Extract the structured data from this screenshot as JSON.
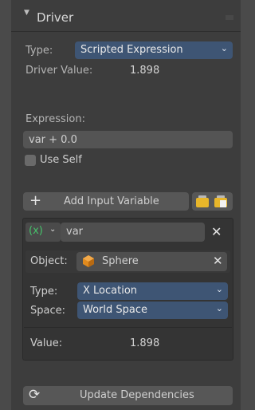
{
  "panel": {
    "title": "Driver"
  },
  "type_row": {
    "label": "Type:",
    "selected": "Scripted Expression"
  },
  "driver_value": {
    "label": "Driver Value:",
    "value": "1.898"
  },
  "expression": {
    "label": "Expression:",
    "value": "var + 0.0"
  },
  "use_self": {
    "label": "Use Self",
    "checked": false
  },
  "add_variable": {
    "label": "Add Input Variable"
  },
  "variable": {
    "type_badge": "(x)",
    "name": "var",
    "object": {
      "label": "Object:",
      "value": "Sphere"
    },
    "type": {
      "label": "Type:",
      "selected": "X Location"
    },
    "space": {
      "label": "Space:",
      "selected": "World Space"
    },
    "value": {
      "label": "Value:",
      "value": "1.898"
    }
  },
  "update": {
    "label": "Update Dependencies"
  },
  "colors": {
    "accent": "#3e5574",
    "badge": "#46c36b",
    "object_icon": "#e08a1e"
  }
}
